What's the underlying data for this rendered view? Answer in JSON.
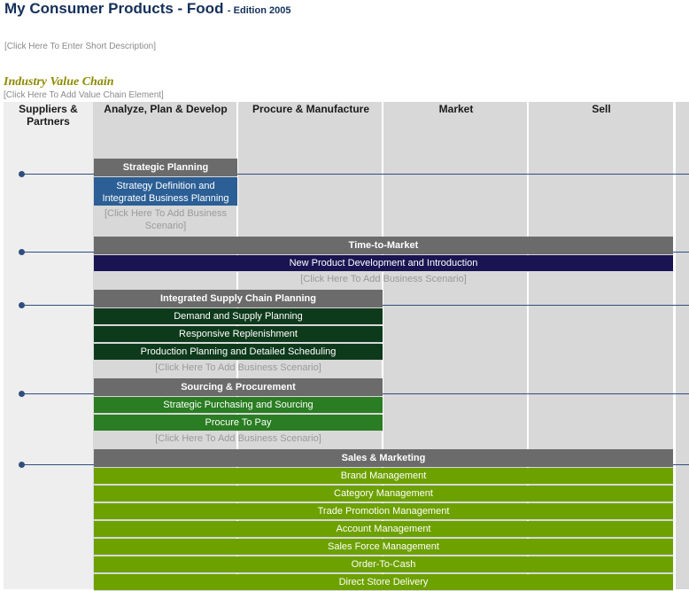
{
  "header": {
    "title": "My Consumer Products - Food",
    "edition": "- Edition 2005",
    "short_description_hint": "[Click Here To Enter Short Description]"
  },
  "value_chain": {
    "title": "Industry Value Chain",
    "add_element_hint": "[Click Here To Add Value Chain Element]",
    "columns": [
      "Suppliers & Partners",
      "Analyze, Plan & Develop",
      "Procure & Manufacture",
      "Market",
      "Sell"
    ]
  },
  "groups": {
    "strategic": {
      "title": "Strategic Planning",
      "rows": [
        "Strategy Definition and Integrated Business Planning"
      ],
      "add_hint": "[Click Here To Add Business Scenario]"
    },
    "ttm": {
      "title": "Time-to-Market",
      "rows": [
        "New Product Development and Introduction"
      ],
      "add_hint": "[Click Here To Add Business Scenario]"
    },
    "iscp": {
      "title": "Integrated Supply Chain Planning",
      "rows": [
        "Demand and Supply Planning",
        "Responsive Replenishment",
        "Production Planning and Detailed Scheduling"
      ],
      "add_hint": "[Click Here To Add Business Scenario]"
    },
    "sourcing": {
      "title": "Sourcing & Procurement",
      "rows": [
        "Strategic Purchasing and Sourcing",
        "Procure To Pay"
      ],
      "add_hint": "[Click Here To Add Business Scenario]"
    },
    "sales": {
      "title": "Sales & Marketing",
      "rows": [
        "Brand Management",
        "Category Management",
        "Trade Promotion Management",
        "Account Management",
        "Sales Force Management",
        "Order-To-Cash",
        "Direct Store Delivery"
      ]
    }
  },
  "colors": {
    "strategic_row": "#2b5f95",
    "ttm_row": "#1b1452",
    "iscp_row": "#0e3a1c",
    "sourcing_row": "#2a7d22",
    "sales_row": "#6da100",
    "group_header": "#6b6b6b",
    "connector": "#2f4e7e"
  }
}
